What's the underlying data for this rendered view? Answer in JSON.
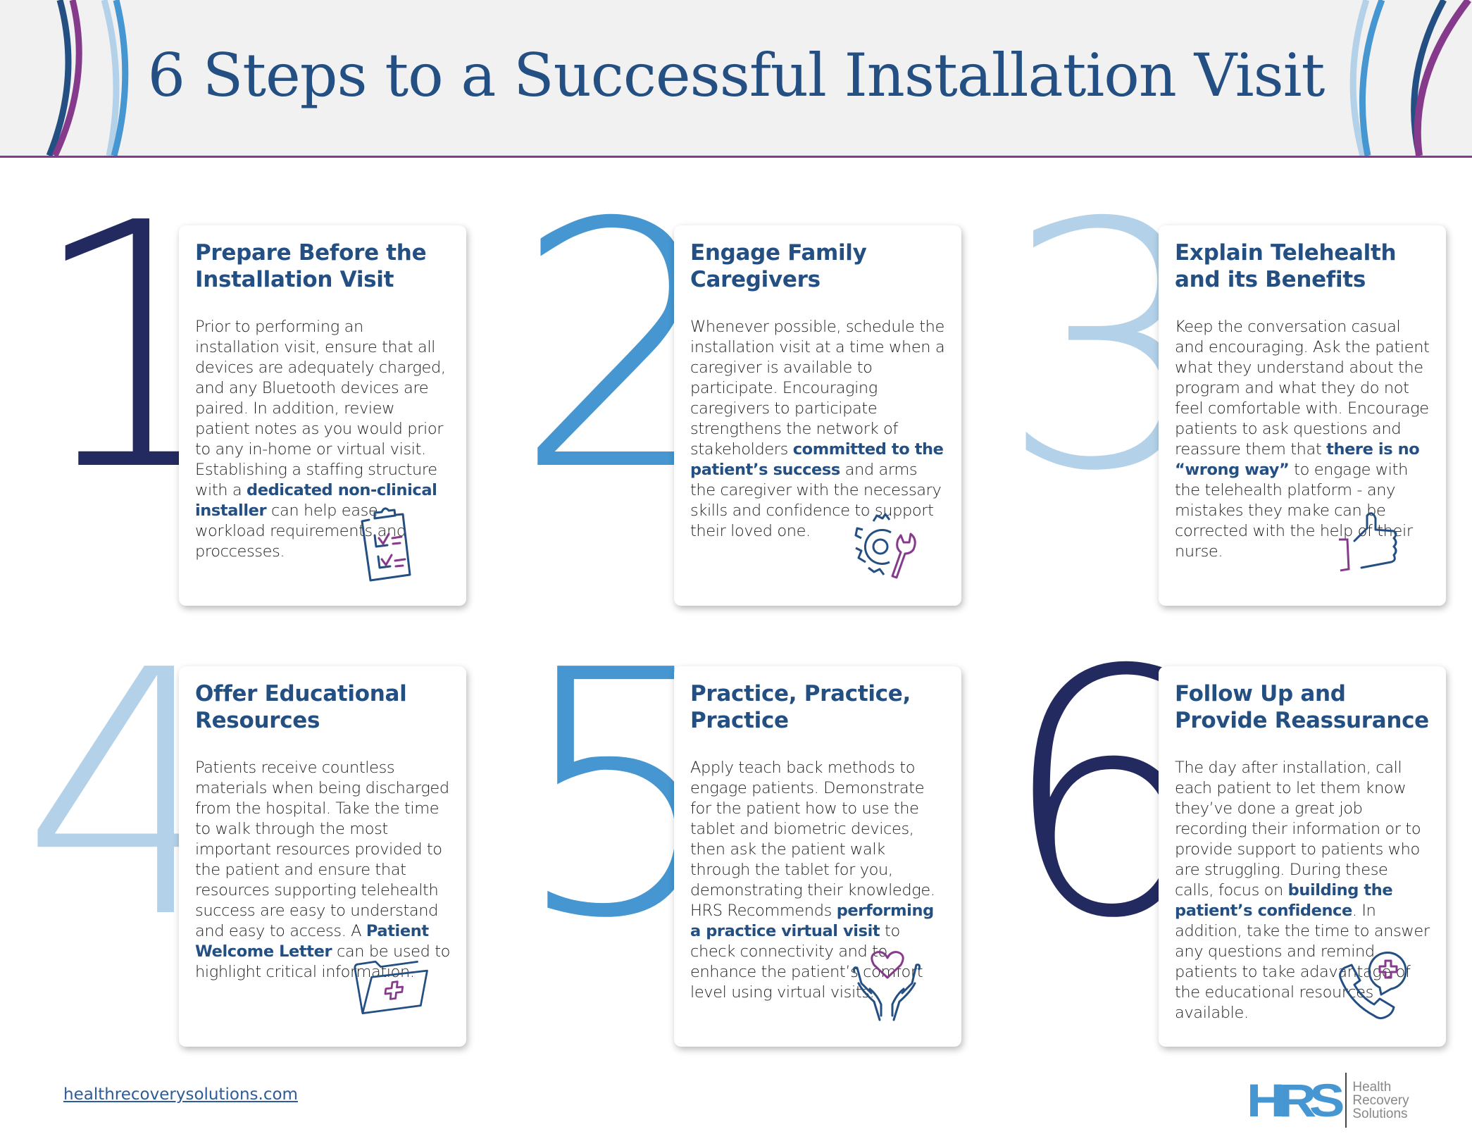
{
  "header": {
    "title": "6 Steps to a Successful Installation Visit"
  },
  "colors": {
    "title_blue": "#244f82",
    "navy": "#232a5f",
    "medium_blue": "#4596d1",
    "light_blue": "#b3d1e8",
    "purple": "#863a8c"
  },
  "steps": [
    {
      "number": "1",
      "title": "Prepare Before the Installation Visit",
      "body_before": "Prior to performing an installation visit, ensure that all devices are adequately charged, and any Bluetooth devices are paired. In addition, review patient notes as you would prior to any in-home or virtual visit. Establishing a staffing structure with a ",
      "body_bold": "dedicated non-clinical installer",
      "body_after": " can help ease workload requirements and proccesses.",
      "icon": "clipboard-checklist-icon"
    },
    {
      "number": "2",
      "title": "Engage Family Caregivers",
      "body_before": "Whenever possible, schedule the installation visit at a time when a caregiver is available to participate. Encouraging caregivers to participate strengthens the network of stakeholders ",
      "body_bold": "committed to the patient’s success",
      "body_after": " and arms the caregiver with the necessary skills and confidence to support their loved one.",
      "icon": "gear-wrench-icon"
    },
    {
      "number": "3",
      "title": "Explain Telehealth and its Benefits",
      "body_before": "Keep the conversation casual and encouraging. Ask the patient what they understand about the program and what they do not feel comfortable with. Encourage patients to ask questions and reassure them that ",
      "body_bold": "there is no “wrong way”",
      "body_after": " to engage with the telehealth platform - any mistakes they make can be corrected with the help of their nurse.",
      "icon": "thumbs-up-icon"
    },
    {
      "number": "4",
      "title": "Offer Educational Resources",
      "body_before": "Patients receive countless materials when being discharged from the hospital. Take the time to walk through the most important resources provided to the patient and ensure that resources supporting telehealth success are easy to understand and easy to access. A ",
      "body_bold": "Patient Welcome Letter",
      "body_after": " can be used to highlight critical information.",
      "icon": "medical-folder-icon"
    },
    {
      "number": "5",
      "title": "Practice, Practice, Practice",
      "body_before": "Apply teach back methods to engage patients. Demonstrate for the patient how to use the tablet and biometric devices, then ask the patient walk through the tablet for you, demonstrating their knowledge. HRS Recommends ",
      "body_bold": "performing a practice virtual visit",
      "body_after": " to check connectivity and to enhance the patient’s comfort level using virtual visits.",
      "icon": "hands-heart-icon"
    },
    {
      "number": "6",
      "title": "Follow Up and Provide Reassurance",
      "body_before": "The day after installation, call each patient to let them know they’ve done a great job recording their information or to provide support to patients who are struggling. During these calls, focus on ",
      "body_bold": "building the patient’s confidence",
      "body_after": ". In addition, take the time to answer any questions and remind patients to take adavantage of the educational resources available.",
      "icon": "phone-medical-icon"
    }
  ],
  "footer": {
    "website": "healthrecoverysolutions.com",
    "logo_mark": "HRS",
    "logo_words": [
      "Health",
      "Recovery",
      "Solutions"
    ]
  }
}
